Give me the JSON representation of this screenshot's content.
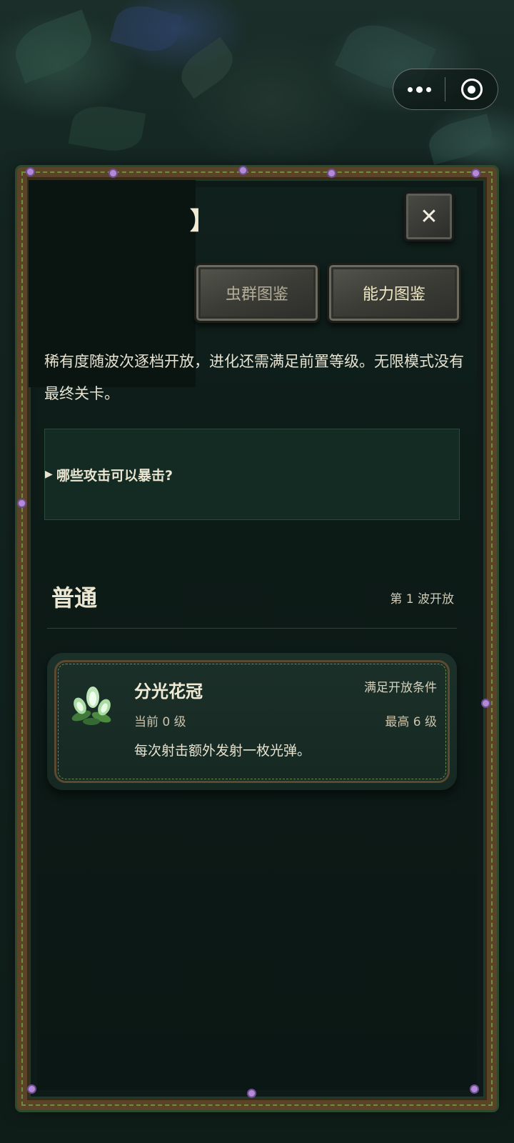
{
  "capsule": {
    "more_icon": "more-dots-icon",
    "close_icon": "target-ring-icon"
  },
  "header": {
    "title_partial": "】",
    "close_label": "✕"
  },
  "tabs": [
    {
      "label": "虫群图鉴",
      "active": false
    },
    {
      "label": "能力图鉴",
      "active": true
    }
  ],
  "description": "稀有度随波次逐档开放，进化还需满足前置等级。无限模式没有最终关卡。",
  "faq": {
    "arrow": "▶",
    "question": "哪些攻击可以暴击?"
  },
  "section": {
    "title": "普通",
    "wave": "第 1 波开放"
  },
  "ability_card": {
    "icon": "glowing-flower-icon",
    "name": "分光花冠",
    "status": "满足开放条件",
    "current_level": "当前 0 级",
    "max_level": "最高 6 级",
    "desc": "每次射击额外发射一枚光弹。"
  },
  "colors": {
    "panel_bg": "#0d1a17",
    "frame": "#5a4326",
    "accent_text": "#f1e7c2",
    "faq_bg": "#142b23"
  }
}
